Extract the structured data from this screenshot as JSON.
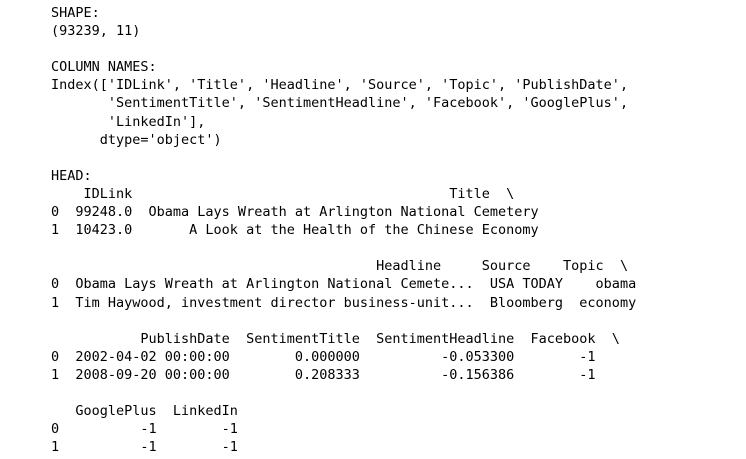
{
  "output": {
    "lines": [
      "SHAPE:",
      "(93239, 11)",
      "",
      "COLUMN NAMES:",
      "Index(['IDLink', 'Title', 'Headline', 'Source', 'Topic', 'PublishDate',",
      "       'SentimentTitle', 'SentimentHeadline', 'Facebook', 'GooglePlus',",
      "       'LinkedIn'],",
      "      dtype='object')",
      "",
      "HEAD:",
      "    IDLink                                       Title  \\",
      "0  99248.0  Obama Lays Wreath at Arlington National Cemetery",
      "1  10423.0       A Look at the Health of the Chinese Economy",
      "",
      "                                        Headline     Source    Topic  \\",
      "0  Obama Lays Wreath at Arlington National Cemete...  USA TODAY    obama",
      "1  Tim Haywood, investment director business-unit...  Bloomberg  economy",
      "",
      "           PublishDate  SentimentTitle  SentimentHeadline  Facebook  \\",
      "0  2002-04-02 00:00:00        0.000000          -0.053300        -1",
      "1  2008-09-20 00:00:00        0.208333          -0.156386        -1",
      "",
      "   GooglePlus  LinkedIn",
      "0          -1        -1",
      "1          -1        -1"
    ]
  }
}
